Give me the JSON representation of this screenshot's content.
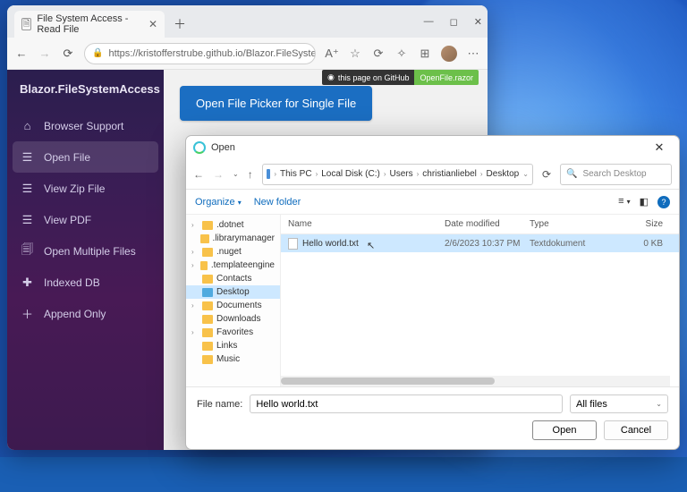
{
  "browser": {
    "tab_title": "File System Access - Read File",
    "url_display": "https://kristofferstrube.github.io/Blazor.FileSystem..."
  },
  "github_badge": {
    "left": "this page on GitHub",
    "right": "OpenFile.razor"
  },
  "brand": "Blazor.FileSystemAccess",
  "nav": {
    "browser_support": "Browser Support",
    "open_file": "Open File",
    "view_zip": "View Zip File",
    "view_pdf": "View PDF",
    "open_multiple": "Open Multiple Files",
    "indexed_db": "Indexed DB",
    "append_only": "Append Only"
  },
  "main": {
    "open_picker_btn": "Open File Picker for Single File"
  },
  "dialog": {
    "title": "Open",
    "crumb": [
      "This PC",
      "Local Disk (C:)",
      "Users",
      "christianliebel",
      "Desktop"
    ],
    "search_placeholder": "Search Desktop",
    "organize": "Organize",
    "new_folder": "New folder",
    "tree": [
      ".dotnet",
      ".librarymanager",
      ".nuget",
      ".templateengine",
      "Contacts",
      "Desktop",
      "Documents",
      "Downloads",
      "Favorites",
      "Links",
      "Music"
    ],
    "tree_selected": "Desktop",
    "columns": {
      "name": "Name",
      "date": "Date modified",
      "type": "Type",
      "size": "Size"
    },
    "rows": [
      {
        "name": "Hello world.txt",
        "date": "2/6/2023 10:37 PM",
        "type": "Textdokument",
        "size": "0 KB",
        "selected": true
      }
    ],
    "file_name_label": "File name:",
    "file_name_value": "Hello world.txt",
    "filter": "All files",
    "open_btn": "Open",
    "cancel_btn": "Cancel"
  }
}
